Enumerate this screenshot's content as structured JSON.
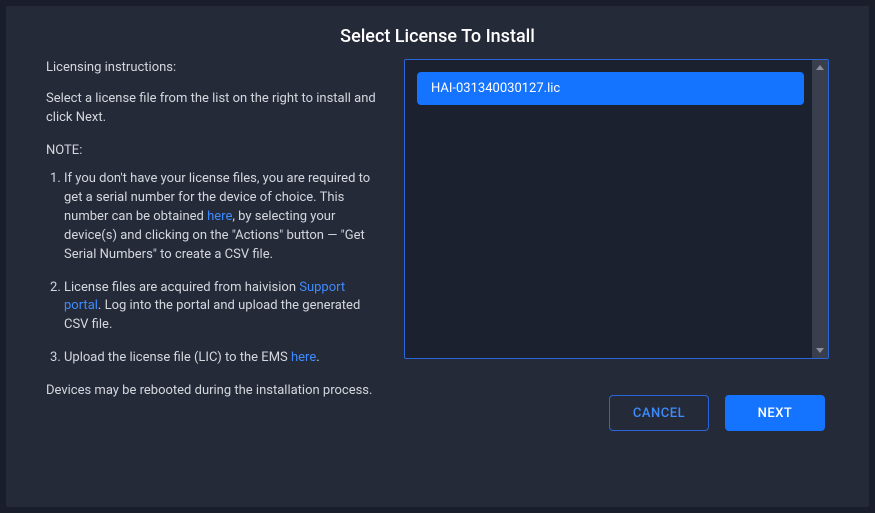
{
  "title": "Select License To Install",
  "left": {
    "subhead": "Licensing instructions:",
    "intro": "Select a license file from the list on the right to install and click Next.",
    "note_label": "NOTE:",
    "items": {
      "i1_pre": "If you don't have your license files, you are required to get a serial number for the device of choice. This number can be obtained ",
      "i1_link": "here",
      "i1_post": ", by selecting your device(s) and clicking on the \"Actions\" button — \"Get Serial Numbers\" to create a CSV file.",
      "i2_pre": "License files are acquired from haivision ",
      "i2_link": "Support portal",
      "i2_post": ". Log into the portal and upload the generated CSV file.",
      "i3_pre": "Upload the license file (LIC) to the EMS ",
      "i3_link": "here",
      "i3_post": "."
    },
    "footer": "Devices may be rebooted during the installation process."
  },
  "list": {
    "selected_item": "HAI-031340030127.lic"
  },
  "buttons": {
    "cancel": "CANCEL",
    "next": "NEXT"
  }
}
